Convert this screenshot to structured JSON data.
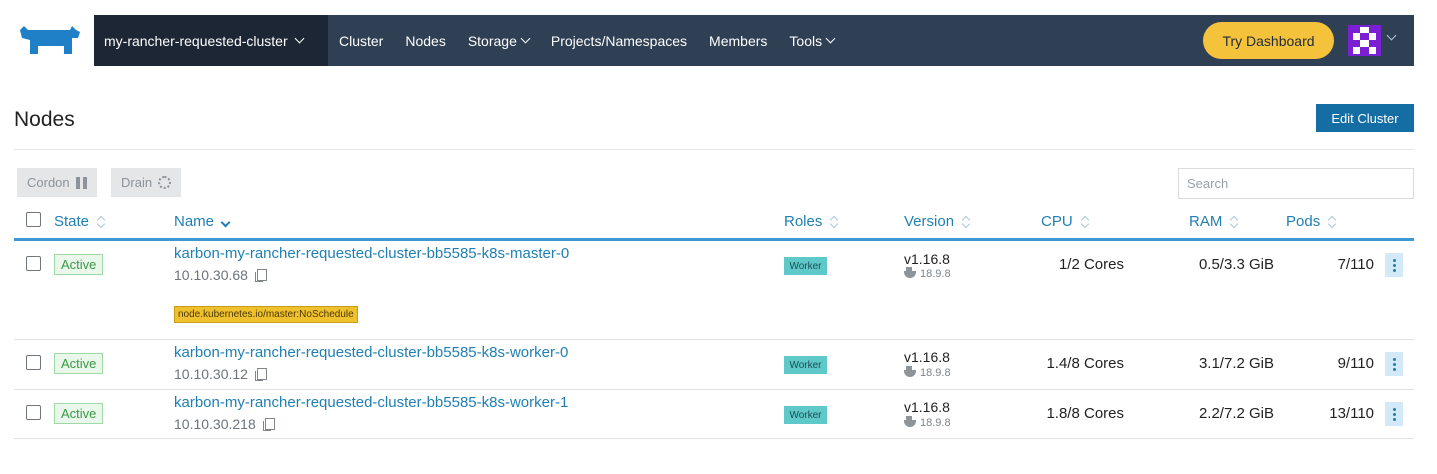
{
  "nav": {
    "cluster": "my-rancher-requested-cluster",
    "items": [
      "Cluster",
      "Nodes",
      "Storage",
      "Projects/Namespaces",
      "Members",
      "Tools"
    ],
    "try_dashboard": "Try Dashboard"
  },
  "page": {
    "title": "Nodes",
    "edit_cluster": "Edit Cluster"
  },
  "actions": {
    "cordon": "Cordon",
    "drain": "Drain"
  },
  "search": {
    "placeholder": "Search"
  },
  "table": {
    "headers": {
      "state": "State",
      "name": "Name",
      "roles": "Roles",
      "version": "Version",
      "cpu": "CPU",
      "ram": "RAM",
      "pods": "Pods"
    },
    "rows": [
      {
        "state": "Active",
        "name": "karbon-my-rancher-requested-cluster-bb5585-k8s-master-0",
        "ip": "10.10.30.68",
        "taint": "node.kubernetes.io/master:NoSchedule",
        "role": "Worker",
        "version": "v1.16.8",
        "docker": "18.9.8",
        "cpu": "1/2 Cores",
        "ram": "0.5/3.3 GiB",
        "pods": "7/110"
      },
      {
        "state": "Active",
        "name": "karbon-my-rancher-requested-cluster-bb5585-k8s-worker-0",
        "ip": "10.10.30.12",
        "role": "Worker",
        "version": "v1.16.8",
        "docker": "18.9.8",
        "cpu": "1.4/8 Cores",
        "ram": "3.1/7.2 GiB",
        "pods": "9/110"
      },
      {
        "state": "Active",
        "name": "karbon-my-rancher-requested-cluster-bb5585-k8s-worker-1",
        "ip": "10.10.30.218",
        "role": "Worker",
        "version": "v1.16.8",
        "docker": "18.9.8",
        "cpu": "1.8/8 Cores",
        "ram": "2.2/7.2 GiB",
        "pods": "13/110"
      }
    ]
  },
  "colors": {
    "navbar": "#2f3f54",
    "accent": "#146da3",
    "link": "#1f7fb3",
    "try_button": "#f5c33b"
  }
}
